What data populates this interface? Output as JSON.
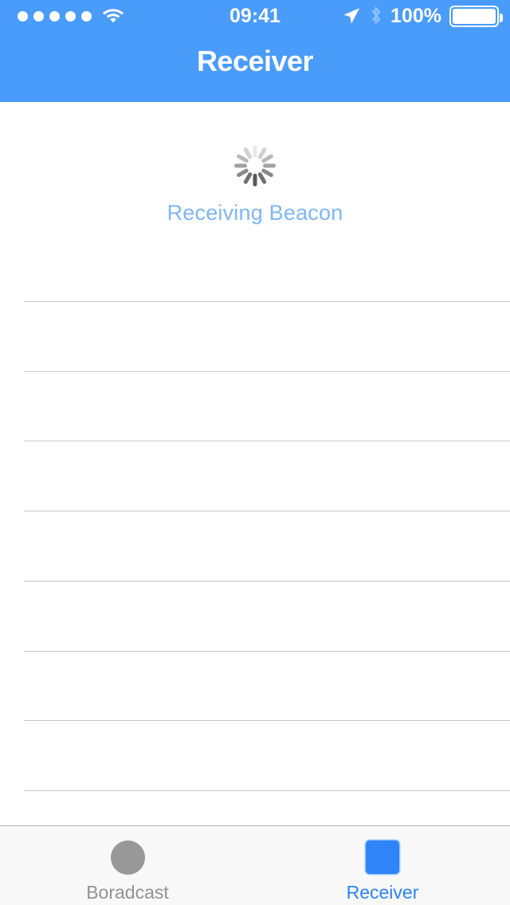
{
  "status_bar": {
    "signal_dots": 5,
    "wifi_icon": "wifi-icon",
    "time": "09:41",
    "location_icon": "location-arrow-icon",
    "bluetooth_icon": "bluetooth-icon",
    "battery_percent": "100%",
    "battery_icon": "battery-full-icon"
  },
  "nav": {
    "title": "Receiver",
    "background_color": "#4a9cfb",
    "title_color": "#ffffff"
  },
  "main": {
    "spinner_icon": "activity-indicator-icon",
    "status_label": "Receiving Beacon",
    "status_label_color": "#7eb6f5",
    "table": {
      "row_count": 8,
      "separator_color": "#c8c7cc",
      "rows": [
        "",
        "",
        "",
        "",
        "",
        "",
        "",
        ""
      ]
    }
  },
  "tabbar": {
    "background_color": "#f8f8f8",
    "active_color": "#2f84f7",
    "inactive_color": "#929292",
    "tabs": [
      {
        "label": "Boradcast",
        "icon": "circle-icon",
        "active": false
      },
      {
        "label": "Receiver",
        "icon": "square-icon",
        "active": true
      }
    ]
  }
}
